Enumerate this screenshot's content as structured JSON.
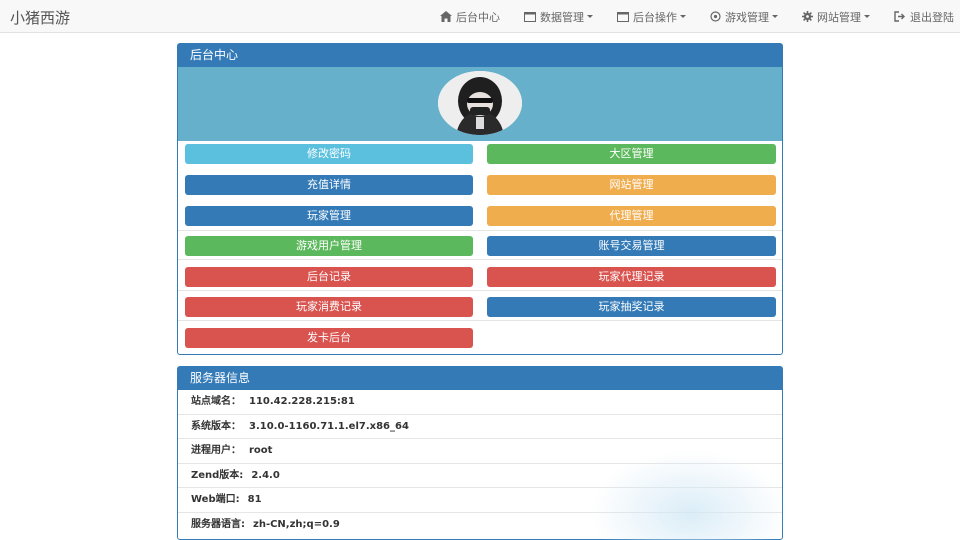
{
  "brand": "小猪西游",
  "nav": {
    "home": "后台中心",
    "data": "数据管理",
    "ops": "后台操作",
    "game": "游戏管理",
    "site": "网站管理",
    "logout": "退出登陆"
  },
  "main_panel": {
    "title": "后台中心",
    "buttons": {
      "change_password": "修改密码",
      "region_manage": "大区管理",
      "recharge_details": "充值详情",
      "site_manage": "网站管理",
      "player_manage": "玩家管理",
      "agent_manage": "代理管理",
      "game_user_manage": "游戏用户管理",
      "account_trade_manage": "账号交易管理",
      "admin_log": "后台记录",
      "player_agent_log": "玩家代理记录",
      "player_spend_log": "玩家消费记录",
      "player_lottery_log": "玩家抽奖记录",
      "card_admin": "发卡后台"
    }
  },
  "server_panel": {
    "title": "服务器信息",
    "rows": [
      {
        "label": "站点域名：",
        "value": "110.42.228.215:81"
      },
      {
        "label": "系统版本：",
        "value": "3.10.0-1160.71.1.el7.x86_64"
      },
      {
        "label": "进程用户：",
        "value": "root"
      },
      {
        "label": "Zend版本:",
        "value": "2.4.0"
      },
      {
        "label": "Web端口:",
        "value": "81"
      },
      {
        "label": "服务器语言:",
        "value": "zh-CN,zh;q=0.9"
      }
    ]
  },
  "colors": {
    "primary": "#337ab7",
    "info": "#5bc0de",
    "success": "#5cb85c",
    "warning": "#f0ad4e",
    "danger": "#d9534f"
  }
}
